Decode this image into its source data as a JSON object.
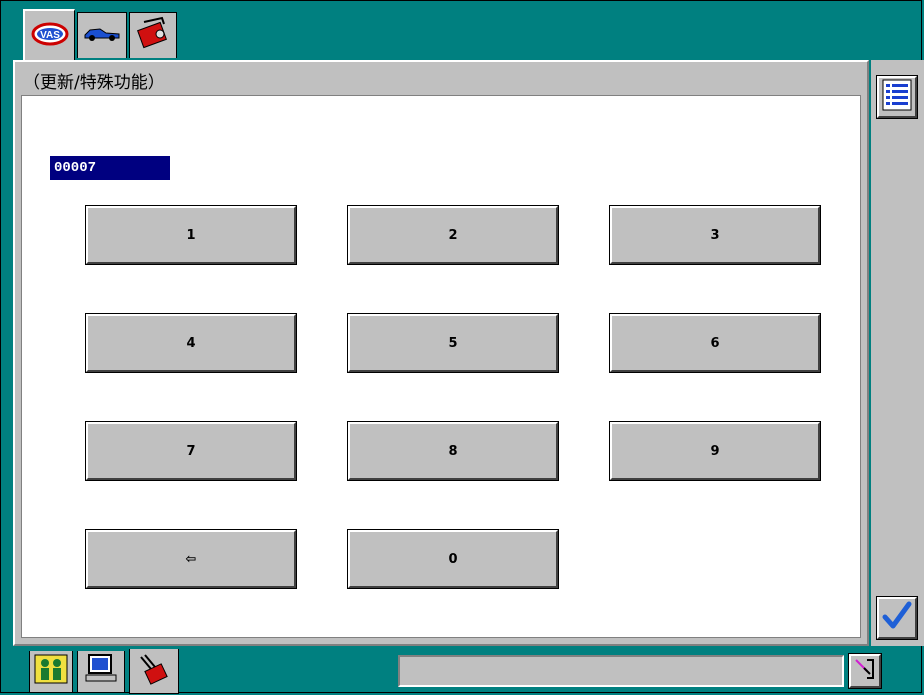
{
  "header": {
    "tabs": [
      {
        "icon": "vas-logo-icon"
      },
      {
        "icon": "car-icon"
      },
      {
        "icon": "toolbox-icon"
      }
    ],
    "title": "（更新/特殊功能）"
  },
  "input": {
    "value": "00007"
  },
  "keypad": {
    "keys": [
      "1",
      "2",
      "3",
      "4",
      "5",
      "6",
      "7",
      "8",
      "9",
      "⇦",
      "0"
    ]
  },
  "side": {
    "list_icon": "list-icon",
    "confirm_icon": "checkmark-icon"
  },
  "footer": {
    "tabs": [
      {
        "icon": "people-icon"
      },
      {
        "icon": "computer-icon"
      },
      {
        "icon": "multimeter-icon"
      }
    ],
    "status_text": "",
    "status_icon": "pen-tool-icon"
  },
  "colors": {
    "background": "#008080",
    "panel": "#c0c0c0",
    "value_box": "#000080",
    "check": "#1e5fd6"
  }
}
